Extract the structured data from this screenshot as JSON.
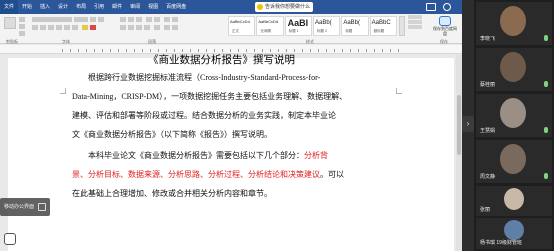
{
  "ribbon": {
    "tabs": [
      "文件",
      "开始",
      "插入",
      "设计",
      "布局",
      "引用",
      "邮件",
      "审阅",
      "视图",
      "百度网盘"
    ],
    "notice": "告诉我你想要做什么",
    "styles": [
      {
        "sample": "AaBbCcDd",
        "name": "正文"
      },
      {
        "sample": "AaBbCcDd",
        "name": "无间隔"
      },
      {
        "sample": "AaBl",
        "name": "标题 1"
      },
      {
        "sample": "AaBb(",
        "name": "标题 2"
      },
      {
        "sample": "AaBb(",
        "name": "标题"
      },
      {
        "sample": "AaBbC",
        "name": "副标题"
      }
    ],
    "groups": {
      "clipboard": "剪贴板",
      "font": "字体",
      "paragraph": "段落",
      "styles": "样式",
      "save": "保存"
    },
    "save_label": "保存到百度网盘"
  },
  "document": {
    "title": "《商业数据分析报告》撰写说明",
    "para1_lines": [
      "根据跨行业数据挖掘标准流程（Cross-Industry-Standard-Process-for-",
      "Data-Mining，CRISP-DM），一项数据挖掘任务主要包括业务理解、数据理解、",
      "建模、评估和部署等阶段或过程。结合数据分析的业务实践，制定本毕业论",
      "文《商业数据分析报告》（以下简称《报告》）撰写说明。"
    ],
    "para2": {
      "line1_prefix": "本科毕业论文《商业数据分析报告》需要包括以下几个部分：",
      "line1_red": "分析背",
      "line2_red": "景、分析目标、数据来源、分析思路、分析过程、分析结论和决策建议",
      "line2_suffix": "。可以",
      "line3": "在此基础上合理增加、修改或合并相关分析内容和章节。"
    }
  },
  "overlay": {
    "connector_text": "移动办公界面"
  },
  "participants": [
    {
      "name": "李晓飞",
      "color": "#8a6b4f"
    },
    {
      "name": "蔡桂丽",
      "color": "#6d5a4a"
    },
    {
      "name": "王慧娟",
      "color": "#9b8e84"
    },
    {
      "name": "周文静",
      "color": "#7a6a5e"
    },
    {
      "name": "张丽",
      "color": "#c8b8a8"
    },
    {
      "name": "杨书琪 19级财管班",
      "color": "#5f7fa6"
    }
  ]
}
